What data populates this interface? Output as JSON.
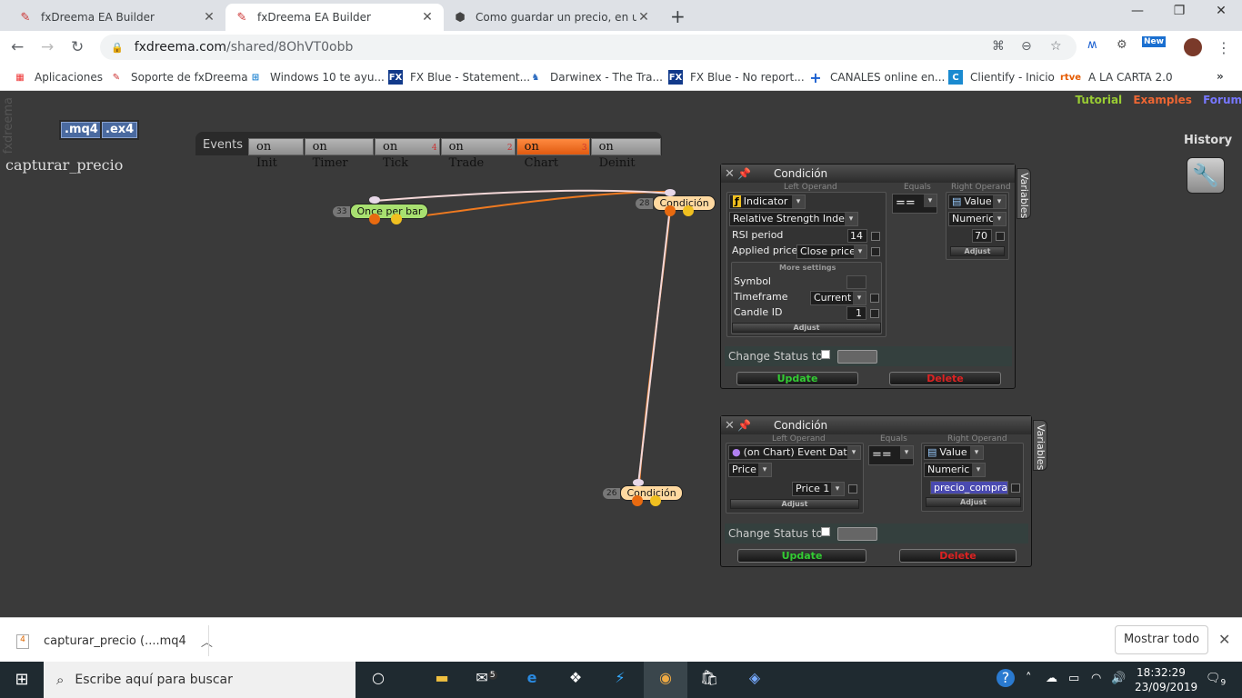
{
  "browser": {
    "tabs": [
      {
        "title": "fxDreema EA Builder",
        "active": false
      },
      {
        "title": "fxDreema EA Builder",
        "active": true
      },
      {
        "title": "Como guardar un precio, en una",
        "active": false
      }
    ],
    "url_domain": "fxdreema.com",
    "url_path": "/shared/8OhVT0obb",
    "bookmarks": [
      "Aplicaciones",
      "Soporte de fxDreema",
      "Windows 10 te ayu...",
      "FX Blue - Statement...",
      "Darwinex - The Tra...",
      "FX Blue - No report...",
      "CANALES online en...",
      "Clientify - Inicio",
      "A LA CARTA 2.0"
    ],
    "bookmark_badges": {
      "fx": "FX",
      "rtve": "rtve",
      "new": "New"
    }
  },
  "app": {
    "side_logo": "fxdreema",
    "file_buttons": [
      ".mq4",
      ".ex4"
    ],
    "top_links": {
      "tutorial": "Tutorial",
      "examples": "Examples",
      "forum": "Forum"
    },
    "history": "History",
    "events_label": "Events",
    "event_tabs": [
      {
        "label": "on Init",
        "count": ""
      },
      {
        "label": "on Timer",
        "count": ""
      },
      {
        "label": "on Tick",
        "count": "4"
      },
      {
        "label": "on Trade",
        "count": "2"
      },
      {
        "label": "on Chart",
        "count": "3"
      },
      {
        "label": "on Deinit",
        "count": ""
      }
    ],
    "project_name": "capturar_precio",
    "blocks": [
      {
        "id": "33",
        "label": "Once per bar",
        "color": "#a8e070"
      },
      {
        "id": "28",
        "label": "Condición",
        "color": "#ffd9a0"
      },
      {
        "id": "26",
        "label": "Condición",
        "color": "#ffd9a0"
      }
    ]
  },
  "panel1": {
    "title": "Condición",
    "side_tab": "Variables",
    "left_title": "Left Operand",
    "equals_title": "Equals",
    "right_title": "Right Operand",
    "left_type": "Indicator",
    "indicator": "Relative Strength Index",
    "rsi_label": "RSI period",
    "rsi_value": "14",
    "applied_label": "Applied price",
    "applied_value": "Close price",
    "more_settings": "More settings",
    "symbol_label": "Symbol",
    "timeframe_label": "Timeframe",
    "timeframe_value": "Current",
    "candle_label": "Candle ID",
    "candle_value": "1",
    "adjust": "Adjust",
    "operator": "==",
    "right_type": "Value",
    "right_subtype": "Numeric",
    "right_value": "70",
    "right_adjust": "Adjust",
    "status_label": "Change Status to",
    "update": "Update",
    "delete": "Delete"
  },
  "panel2": {
    "title": "Condición",
    "side_tab": "Variables",
    "left_title": "Left Operand",
    "equals_title": "Equals",
    "right_title": "Right Operand",
    "left_type": "(on Chart) Event Data",
    "left_sub": "Price",
    "left_price": "Price 1",
    "adjust": "Adjust",
    "operator": "==",
    "right_type": "Value",
    "right_subtype": "Numeric",
    "right_value": "precio_compra",
    "right_adjust": "Adjust",
    "status_label": "Change Status to",
    "update": "Update",
    "delete": "Delete"
  },
  "downloads": {
    "file": "capturar_precio (....mq4",
    "show_all": "Mostrar todo"
  },
  "taskbar": {
    "search_placeholder": "Escribe aquí para buscar",
    "mail_badge": "5",
    "notification_badge": "9",
    "time": "18:32:29",
    "date": "23/09/2019"
  }
}
